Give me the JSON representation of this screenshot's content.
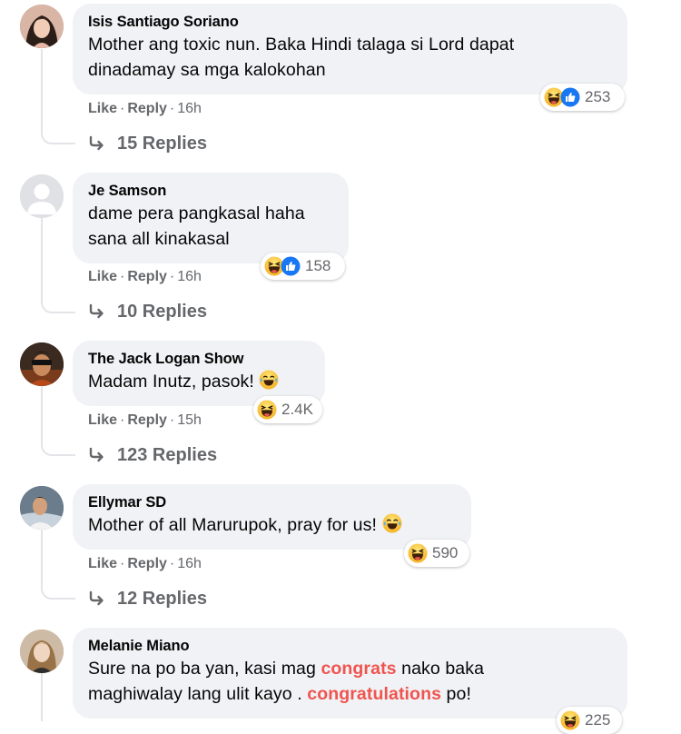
{
  "common": {
    "like_label": "Like",
    "reply_label": "Reply",
    "separator": "·"
  },
  "comments": [
    {
      "author": "Isis Santiago Soriano",
      "text_line1": "Mother ang toxic nun. Baka Hindi talaga si Lord dapat",
      "text_line2": "dinadamay sa mga kalokohan",
      "time": "16h",
      "reaction_count": "253",
      "reaction_icons": [
        "haha-icon",
        "like-icon"
      ],
      "replies": "15 Replies"
    },
    {
      "author": "Je Samson",
      "text_line1": "dame pera pangkasal haha",
      "text_line2": "sana all kinakasal",
      "time": "16h",
      "reaction_count": "158",
      "reaction_icons": [
        "haha-icon",
        "like-icon"
      ],
      "replies": "10 Replies"
    },
    {
      "author": "The Jack Logan Show",
      "text_line1": "Madam Inutz, pasok!",
      "time": "15h",
      "reaction_count": "2.4K",
      "reaction_icons": [
        "haha-icon"
      ],
      "replies": "123 Replies"
    },
    {
      "author": "Ellymar SD",
      "text_line1": "Mother of all Marurupok, pray for us!",
      "time": "16h",
      "reaction_count": "590",
      "reaction_icons": [
        "haha-icon"
      ],
      "replies": "12 Replies"
    },
    {
      "author": "Melanie Miano",
      "text_a": "Sure na po ba yan, kasi mag ",
      "text_hl1": "congrats",
      "text_b": " nako baka",
      "text_c": "maghiwalay lang ulit kayo . ",
      "text_hl2": "congratulations",
      "text_d": " po!",
      "reaction_count": "225",
      "reaction_icons": [
        "haha-icon"
      ]
    }
  ],
  "colors": {
    "bubble": "#f0f2f5",
    "meta": "#65676b",
    "highlight": "#f0544f",
    "like_blue": "#1877f2",
    "haha_yellow": "#f7b125"
  }
}
